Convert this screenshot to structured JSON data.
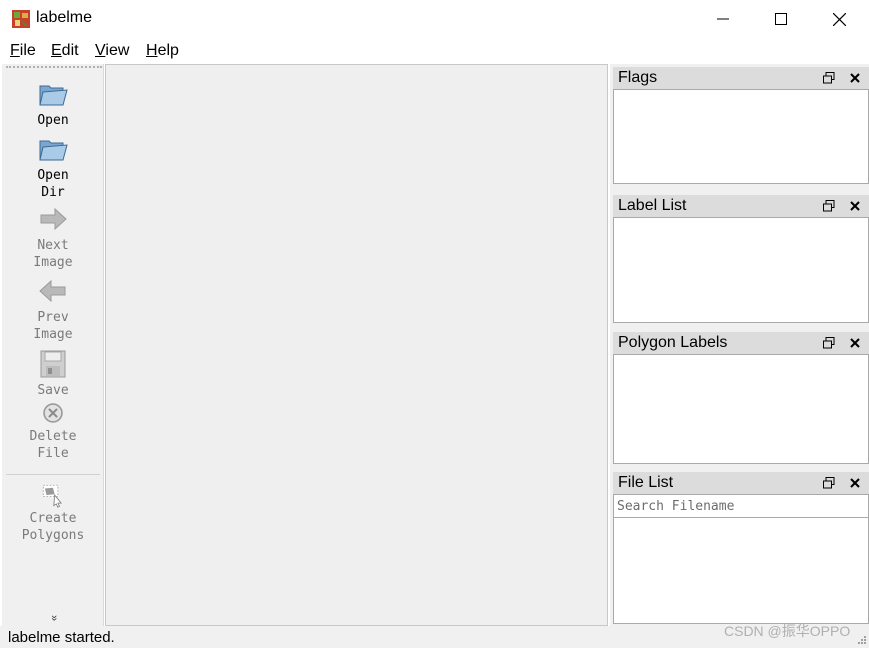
{
  "window": {
    "title": "labelme",
    "controls": {
      "minimize": "minimize-icon",
      "maximize": "maximize-icon",
      "close": "close-icon"
    }
  },
  "menu": [
    {
      "first": "F",
      "rest": "ile"
    },
    {
      "first": "E",
      "rest": "dit"
    },
    {
      "first": "V",
      "rest": "iew"
    },
    {
      "first": "H",
      "rest": "elp"
    }
  ],
  "toolbar": {
    "open": {
      "label": "Open",
      "icon": "folder-open-icon",
      "enabled": true
    },
    "open_dir": {
      "label": "Open\nDir",
      "icon": "folder-open-icon",
      "enabled": true
    },
    "next_image": {
      "label": "Next\nImage",
      "icon": "arrow-right-icon",
      "enabled": false
    },
    "prev_image": {
      "label": "Prev\nImage",
      "icon": "arrow-left-icon",
      "enabled": false
    },
    "save": {
      "label": "Save",
      "icon": "floppy-disk-icon",
      "enabled": false
    },
    "delete_file": {
      "label": "Delete\nFile",
      "icon": "delete-circle-icon",
      "enabled": false
    },
    "create_polygons": {
      "label": "Create\nPolygons",
      "icon": "polygon-icon",
      "enabled": false
    },
    "extension": "»"
  },
  "docks": {
    "flags": {
      "title": "Flags"
    },
    "label_list": {
      "title": "Label List"
    },
    "polygon_labels": {
      "title": "Polygon Labels"
    },
    "file_list": {
      "title": "File List",
      "search_placeholder": "Search Filename"
    }
  },
  "status": {
    "text": "labelme started."
  },
  "watermark": "CSDN @振华OPPO",
  "colors": {
    "canvas": "#efefef",
    "dock_title": "#dcdcdc",
    "panel_bg": "#f0f0f0"
  }
}
